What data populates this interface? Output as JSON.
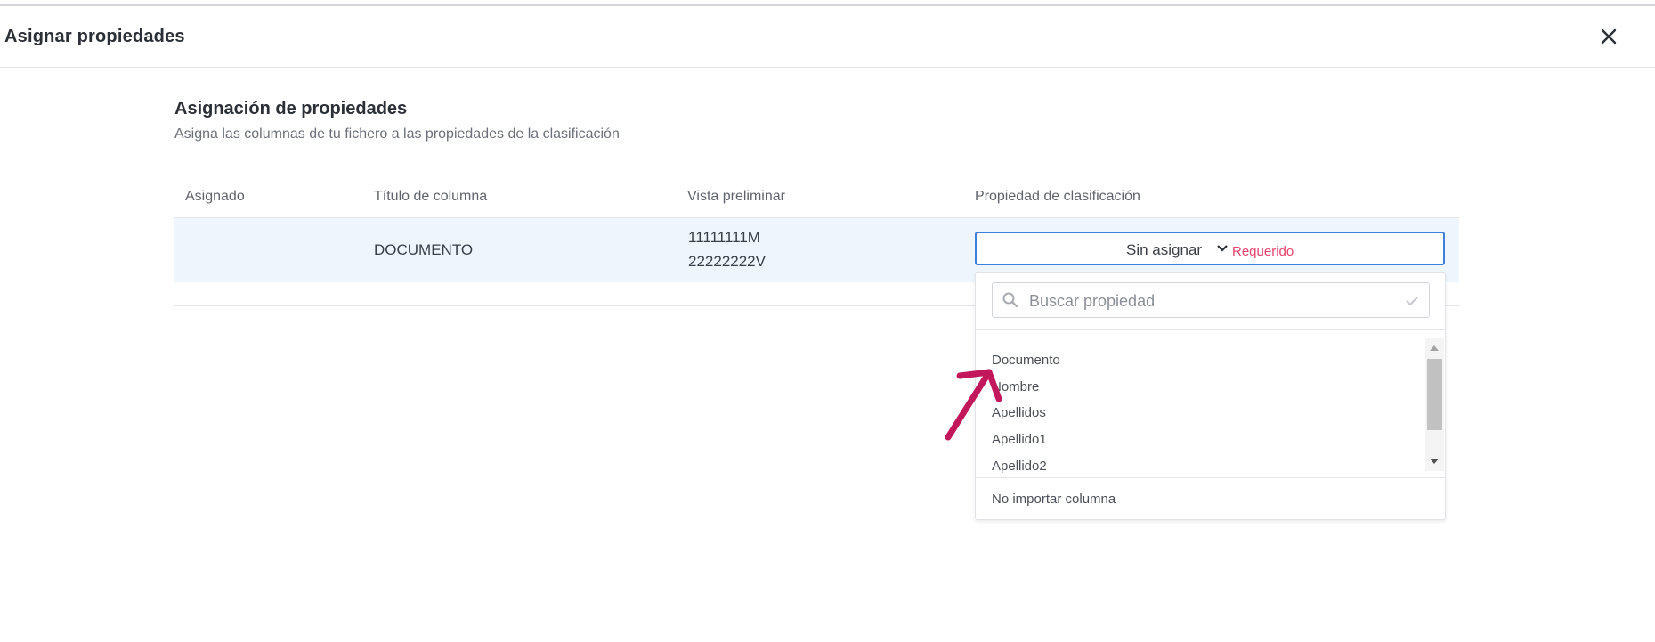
{
  "dialog": {
    "title": "Asignar propiedades",
    "close_icon": "close-icon"
  },
  "section": {
    "title": "Asignación de propiedades",
    "subtitle": "Asigna las columnas de tu fichero a las propiedades de la clasificación"
  },
  "table": {
    "headers": [
      "Asignado",
      "Título de columna",
      "Vista preliminar",
      "Propiedad de clasificación"
    ],
    "rows": [
      {
        "assigned": "",
        "column_title": "DOCUMENTO",
        "preview": [
          "11111111M",
          "22222222V"
        ],
        "property": {
          "value": "Sin asignar",
          "required_label": "Requerido"
        }
      }
    ]
  },
  "dropdown": {
    "search_placeholder": "Buscar propiedad",
    "options": [
      "Documento",
      "Nombre",
      "Apellidos",
      "Apellido1",
      "Apellido2"
    ],
    "footer_option": "No importar columna"
  },
  "colors": {
    "accent_border": "#3f7fdc",
    "row_highlight": "#eef5fd",
    "required": "#e8416b",
    "annotation_arrow": "#c2185b"
  }
}
